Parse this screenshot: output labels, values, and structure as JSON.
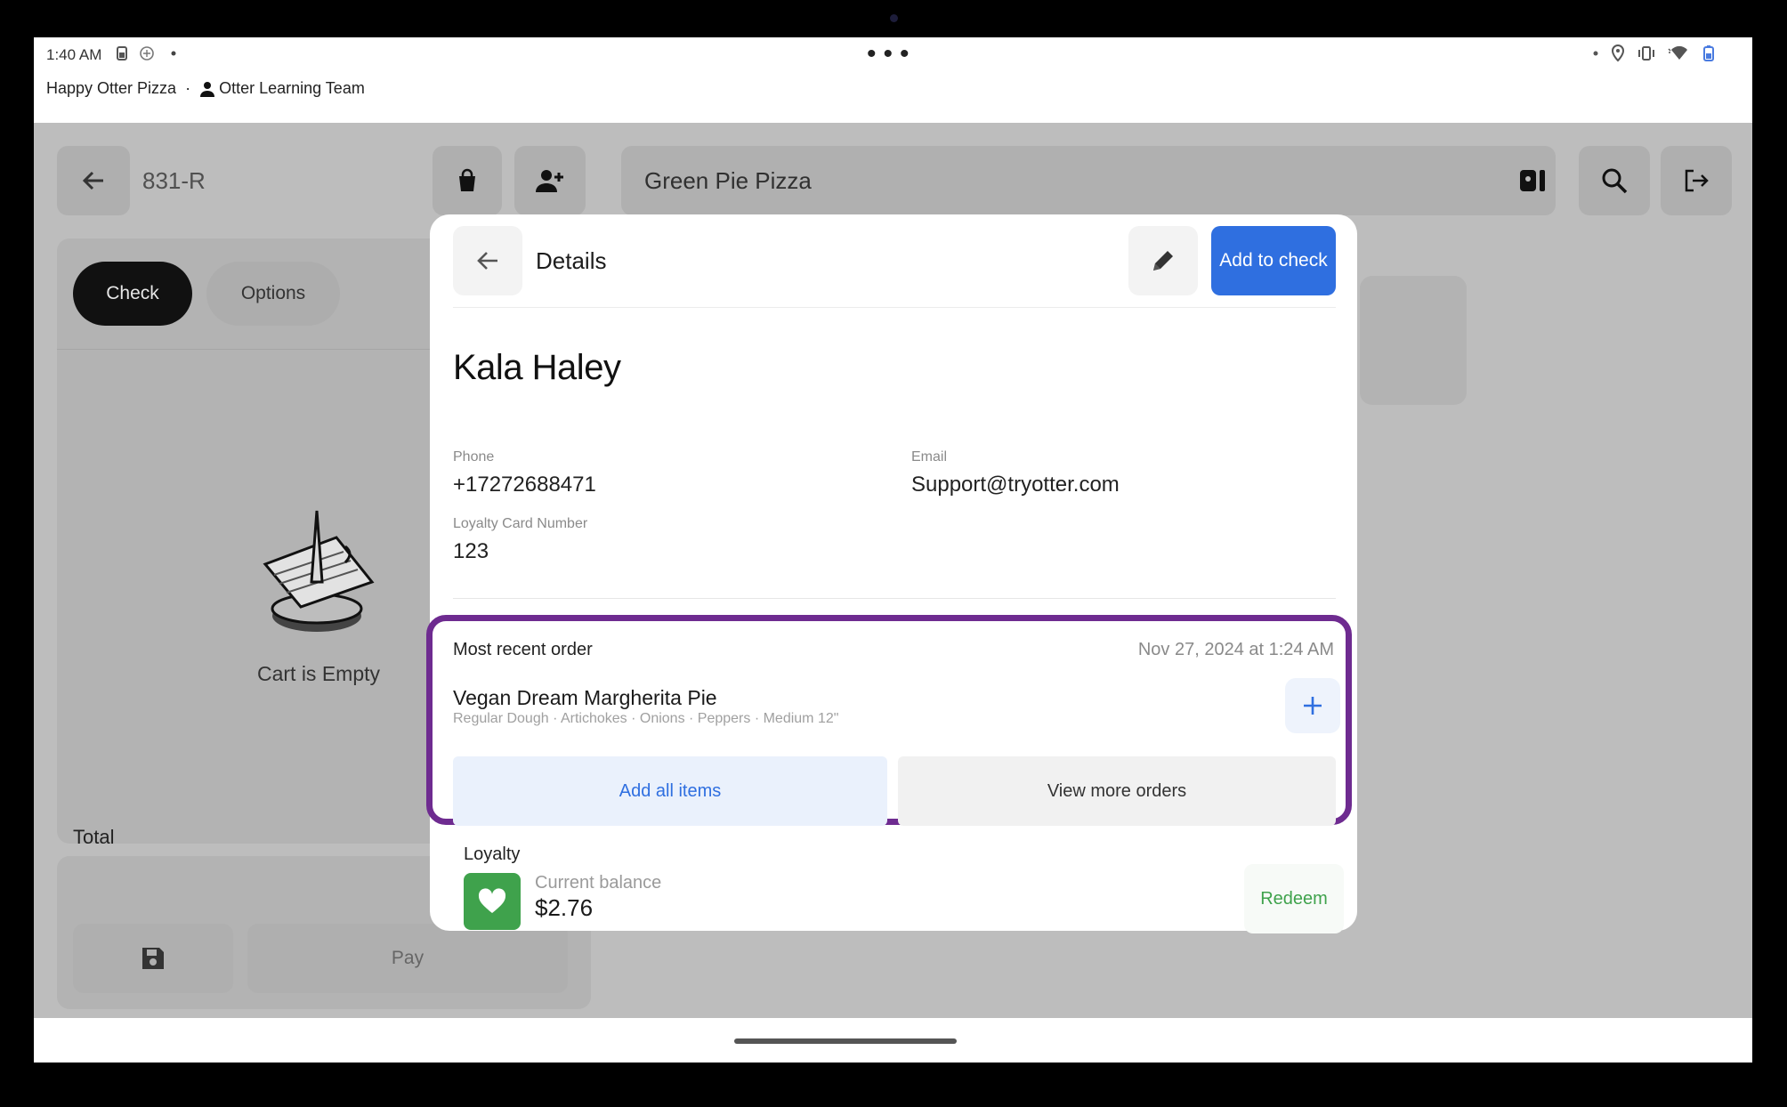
{
  "status_bar": {
    "time": "1:40 AM"
  },
  "subheader": {
    "store": "Happy Otter Pizza",
    "separator": "·",
    "team": "Otter Learning Team"
  },
  "app": {
    "order_id": "831-R",
    "store_name": "Green Pie Pizza",
    "tabs": {
      "check": "Check",
      "options": "Options"
    },
    "cart_empty": "Cart is Empty",
    "total_label": "Total",
    "pay_label": "Pay"
  },
  "modal": {
    "title": "Details",
    "add_to_check": "Add to check",
    "customer_name": "Kala Haley",
    "phone_label": "Phone",
    "phone_value": "+17272688471",
    "email_label": "Email",
    "email_value": "Support@tryotter.com",
    "loyalty_card_label": "Loyalty Card Number",
    "loyalty_card_value": "123",
    "recent_order": {
      "label": "Most recent order",
      "date": "Nov 27, 2024 at 1:24 AM",
      "item_name": "Vegan Dream Margherita Pie",
      "item_modifiers": "Regular Dough · Artichokes · Onions · Peppers · Medium 12\"",
      "add_all": "Add all items",
      "view_more": "View more orders"
    },
    "loyalty": {
      "label": "Loyalty",
      "balance_label": "Current balance",
      "balance_value": "$2.76",
      "redeem": "Redeem"
    }
  },
  "colors": {
    "primary": "#2f6fe0",
    "highlight": "#6e2b90",
    "loyalty_green": "#3fa24c"
  }
}
